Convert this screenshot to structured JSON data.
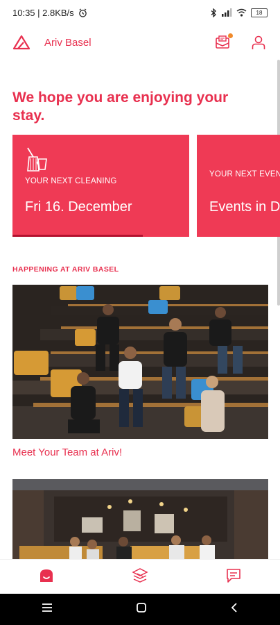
{
  "status_bar": {
    "time_speed": "10:35 | 2.8KB/s",
    "battery": "18"
  },
  "header": {
    "title": "Ariv Basel"
  },
  "greeting": "We hope you are enjoying your stay.",
  "cards": [
    {
      "label": "YOUR NEXT CLEANING",
      "value": "Fri 16. December",
      "icon": "cleaning-icon"
    },
    {
      "label": "YOUR NEXT EVEN",
      "value": "Events in D"
    }
  ],
  "section": {
    "title": "HAPPENING AT ARIV BASEL"
  },
  "events": [
    {
      "title": "Meet Your Team at Ariv!"
    }
  ],
  "bottom_nav": [
    {
      "name": "home-icon"
    },
    {
      "name": "services-icon"
    },
    {
      "name": "chat-icon"
    }
  ],
  "colors": {
    "accent": "#e8304f",
    "card": "#ef3a55",
    "progress": "#b3122f",
    "notification": "#f08a2b"
  }
}
